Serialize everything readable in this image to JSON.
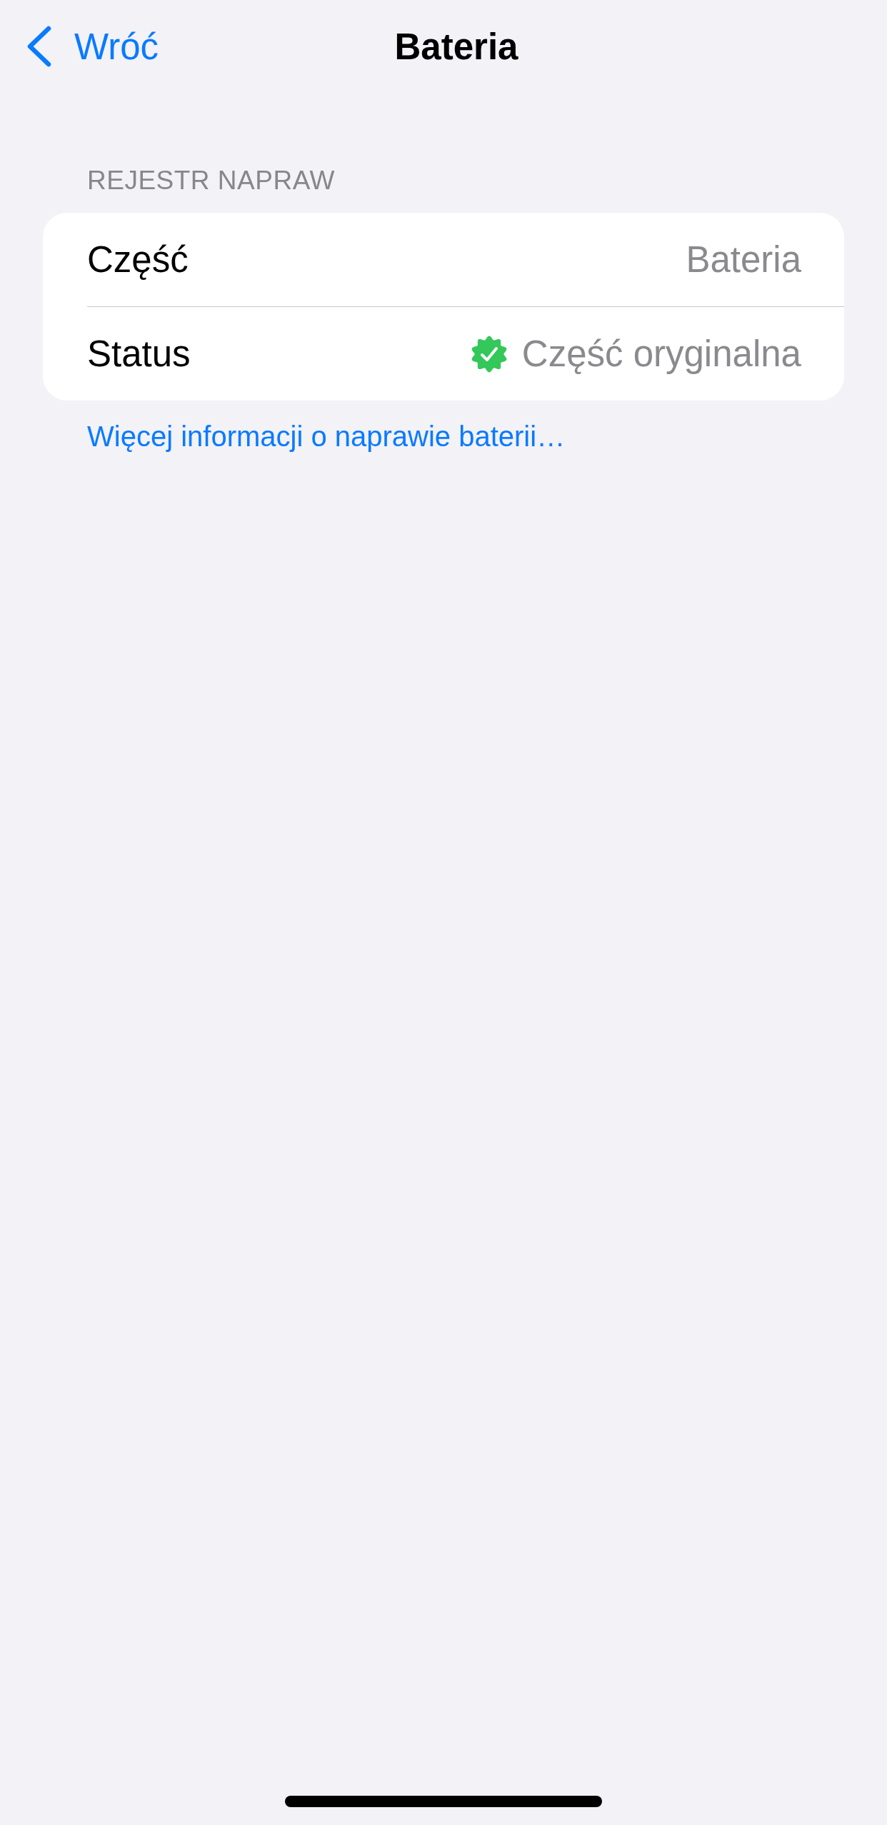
{
  "nav": {
    "back_label": "Wróć",
    "title": "Bateria"
  },
  "section": {
    "header": "REJESTR NAPRAW",
    "rows": [
      {
        "kind": "text",
        "label": "Część",
        "value": "Bateria"
      },
      {
        "kind": "verified",
        "label": "Status",
        "value": "Część oryginalna"
      }
    ]
  },
  "footer_link": "Więcej informacji o naprawie baterii…"
}
